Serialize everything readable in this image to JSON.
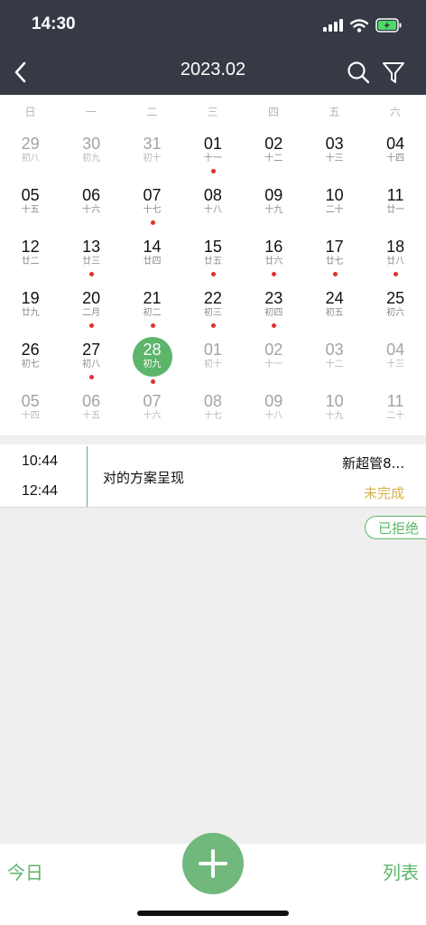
{
  "status_bar": {
    "time": "14:30"
  },
  "nav": {
    "title": "2023.02",
    "icons": [
      "back-icon",
      "search-icon",
      "filter-icon"
    ]
  },
  "colors": {
    "header_bg": "#353a44",
    "accent": "#5cb56b",
    "event_dot": "#e0302a",
    "pending": "#d6b24a"
  },
  "calendar": {
    "weekdays": [
      "日",
      "一",
      "二",
      "三",
      "四",
      "五",
      "六"
    ],
    "selected_day": "28",
    "weeks": [
      [
        {
          "d": "29",
          "l": "初八",
          "other": true,
          "dot": false
        },
        {
          "d": "30",
          "l": "初九",
          "other": true,
          "dot": false
        },
        {
          "d": "31",
          "l": "初十",
          "other": true,
          "dot": false
        },
        {
          "d": "01",
          "l": "十一",
          "other": false,
          "dot": true
        },
        {
          "d": "02",
          "l": "十二",
          "other": false,
          "dot": false
        },
        {
          "d": "03",
          "l": "十三",
          "other": false,
          "dot": false
        },
        {
          "d": "04",
          "l": "十四",
          "other": false,
          "dot": false
        }
      ],
      [
        {
          "d": "05",
          "l": "十五",
          "other": false,
          "dot": false
        },
        {
          "d": "06",
          "l": "十六",
          "other": false,
          "dot": false
        },
        {
          "d": "07",
          "l": "十七",
          "other": false,
          "dot": true
        },
        {
          "d": "08",
          "l": "十八",
          "other": false,
          "dot": false
        },
        {
          "d": "09",
          "l": "十九",
          "other": false,
          "dot": false
        },
        {
          "d": "10",
          "l": "二十",
          "other": false,
          "dot": false
        },
        {
          "d": "11",
          "l": "廿一",
          "other": false,
          "dot": false
        }
      ],
      [
        {
          "d": "12",
          "l": "廿二",
          "other": false,
          "dot": false
        },
        {
          "d": "13",
          "l": "廿三",
          "other": false,
          "dot": true
        },
        {
          "d": "14",
          "l": "廿四",
          "other": false,
          "dot": false
        },
        {
          "d": "15",
          "l": "廿五",
          "other": false,
          "dot": true
        },
        {
          "d": "16",
          "l": "廿六",
          "other": false,
          "dot": true
        },
        {
          "d": "17",
          "l": "廿七",
          "other": false,
          "dot": true
        },
        {
          "d": "18",
          "l": "廿八",
          "other": false,
          "dot": true
        }
      ],
      [
        {
          "d": "19",
          "l": "廿九",
          "other": false,
          "dot": false
        },
        {
          "d": "20",
          "l": "二月",
          "other": false,
          "dot": true
        },
        {
          "d": "21",
          "l": "初二",
          "other": false,
          "dot": true
        },
        {
          "d": "22",
          "l": "初三",
          "other": false,
          "dot": true
        },
        {
          "d": "23",
          "l": "初四",
          "other": false,
          "dot": true
        },
        {
          "d": "24",
          "l": "初五",
          "other": false,
          "dot": false
        },
        {
          "d": "25",
          "l": "初六",
          "other": false,
          "dot": false
        }
      ],
      [
        {
          "d": "26",
          "l": "初七",
          "other": false,
          "dot": false
        },
        {
          "d": "27",
          "l": "初八",
          "other": false,
          "dot": true
        },
        {
          "d": "28",
          "l": "初九",
          "other": false,
          "dot": true
        },
        {
          "d": "01",
          "l": "初十",
          "other": true,
          "dot": false
        },
        {
          "d": "02",
          "l": "十一",
          "other": true,
          "dot": false
        },
        {
          "d": "03",
          "l": "十二",
          "other": true,
          "dot": false
        },
        {
          "d": "04",
          "l": "十三",
          "other": true,
          "dot": false
        }
      ],
      [
        {
          "d": "05",
          "l": "十四",
          "other": true,
          "dot": false
        },
        {
          "d": "06",
          "l": "十五",
          "other": true,
          "dot": false
        },
        {
          "d": "07",
          "l": "十六",
          "other": true,
          "dot": false
        },
        {
          "d": "08",
          "l": "十七",
          "other": true,
          "dot": false
        },
        {
          "d": "09",
          "l": "十八",
          "other": true,
          "dot": false
        },
        {
          "d": "10",
          "l": "十九",
          "other": true,
          "dot": false
        },
        {
          "d": "11",
          "l": "二十",
          "other": true,
          "dot": false
        }
      ]
    ]
  },
  "event": {
    "start": "10:44",
    "end": "12:44",
    "title": "对的方案呈现",
    "owner": "新超管8...",
    "status": "未完成"
  },
  "rejected_badge": "已拒绝",
  "bottom_bar": {
    "today_label": "今日",
    "list_label": "列表",
    "add_icon": "plus-icon"
  }
}
